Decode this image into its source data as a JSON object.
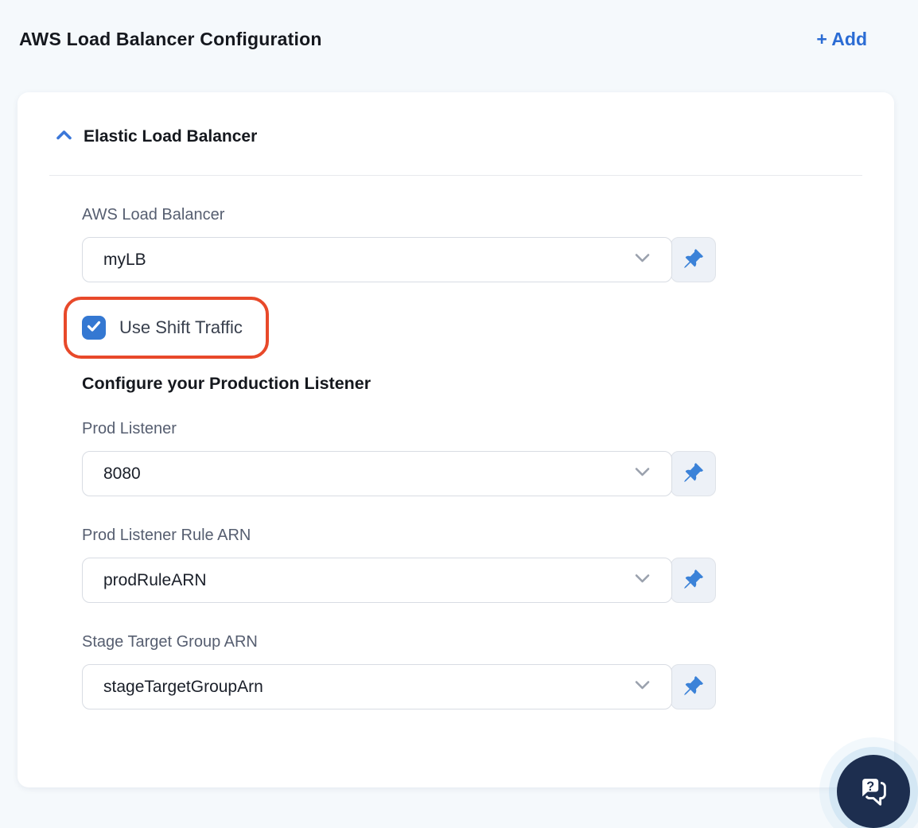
{
  "header": {
    "title": "AWS Load Balancer Configuration",
    "add_label": "+ Add"
  },
  "panel": {
    "section_title": "Elastic Load Balancer",
    "lb_field": {
      "label": "AWS Load Balancer",
      "value": "myLB"
    },
    "checkbox": {
      "label": "Use Shift Traffic",
      "checked": true
    },
    "subheading": "Configure your Production Listener",
    "fields": [
      {
        "label": "Prod Listener",
        "value": "8080"
      },
      {
        "label": "Prod Listener Rule ARN",
        "value": "prodRuleARN"
      },
      {
        "label": "Stage Target Group ARN",
        "value": "stageTargetGroupArn"
      }
    ]
  },
  "icons": {
    "section_chevron": "chevron-up-icon",
    "select_chevron": "chevron-down-icon",
    "pin": "pushpin-icon",
    "checkbox_check": "checkmark-icon",
    "chat": "chat-question-icon"
  },
  "colors": {
    "accent_blue": "#2b6cd4",
    "checkbox_blue": "#3478d2",
    "pin_blue": "#3b82d8",
    "annotation_red": "#e8492a",
    "chat_navy": "#1d2e4f",
    "page_bg": "#f5f9fc"
  }
}
